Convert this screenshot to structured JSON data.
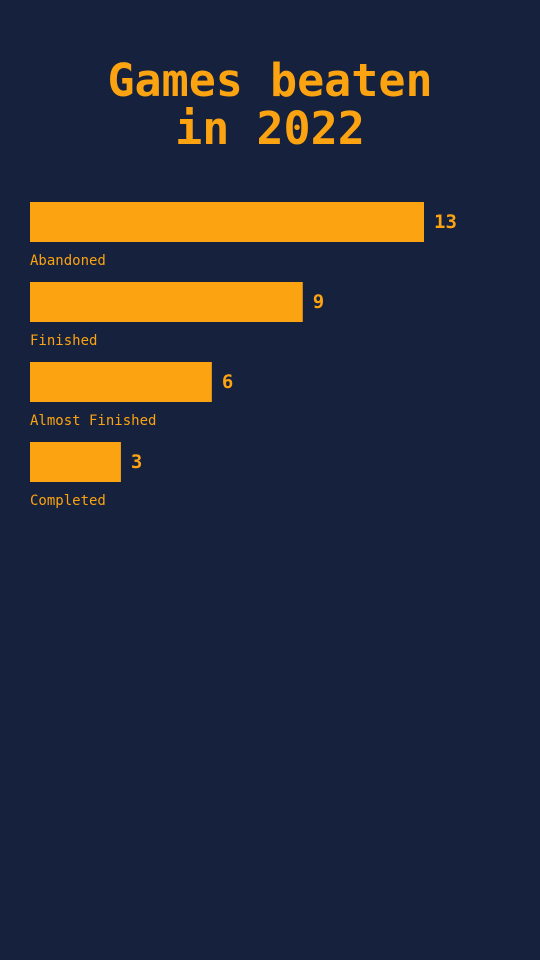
{
  "title_line1": "Games beaten",
  "title_line2": "in 2022",
  "colors": {
    "background": "#15213d",
    "bar": "#fca311",
    "text": "#fca311"
  },
  "chart_data": {
    "type": "bar",
    "orientation": "horizontal",
    "title": "Games beaten in 2022",
    "categories": [
      "Abandoned",
      "Finished",
      "Almost Finished",
      "Completed"
    ],
    "values": [
      13,
      9,
      6,
      3
    ],
    "value_labels": [
      "13",
      "9",
      "6",
      "3"
    ],
    "xlabel": "",
    "ylabel": "",
    "xlim": [
      0,
      13
    ],
    "grid": false,
    "legend": "none"
  }
}
